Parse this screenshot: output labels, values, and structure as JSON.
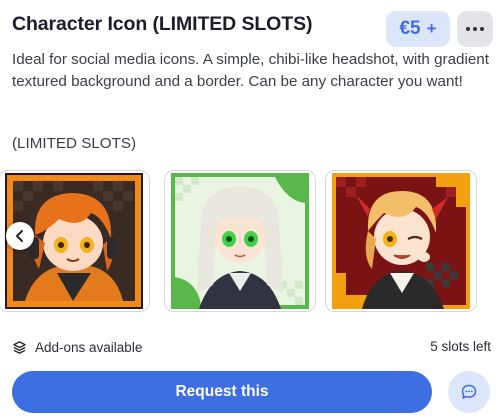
{
  "header": {
    "title": "Character Icon (LIMITED SLOTS)",
    "price": "€5",
    "price_plus": "+",
    "more_icon": "more-horizontal-icon"
  },
  "description": "Ideal for social media icons. A simple, chibi-like headshot, with gradient textured background and a border. Can be any character you want!",
  "slots_note": "(LIMITED SLOTS)",
  "gallery": {
    "items": [
      {
        "character": "orange-haired chibi with headset",
        "accent": "#f08a1a"
      },
      {
        "character": "white-haired chibi with green eyes",
        "accent": "#58b84a"
      },
      {
        "character": "blonde chibi with red horns winking",
        "accent": "#f2a010"
      }
    ],
    "prev_icon": "chevron-left-icon"
  },
  "addons": {
    "label": "Add-ons available",
    "icon": "layers-icon"
  },
  "slots_left": "5 slots left",
  "actions": {
    "request_label": "Request this",
    "chat_icon": "chat-bubble-icon"
  },
  "colors": {
    "primary": "#3d6fe3",
    "primary_soft": "#dce6fb",
    "text": "#1b1d2a"
  }
}
